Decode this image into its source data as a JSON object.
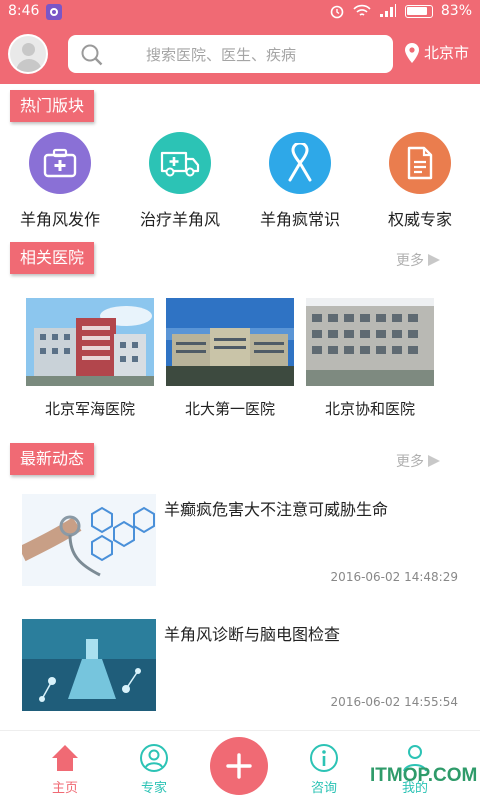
{
  "status": {
    "time": "8:46",
    "battery": "83%"
  },
  "header": {
    "search_placeholder": "搜索医院、医生、疾病",
    "location": "北京市"
  },
  "sections": {
    "hot": "热门版块",
    "hospitals": "相关医院",
    "news": "最新动态",
    "more": "更多"
  },
  "hot_items": [
    {
      "label": "羊角风发作",
      "icon": "medical-kit-icon",
      "color": "#8a70d6"
    },
    {
      "label": "治疗羊角风",
      "icon": "ambulance-icon",
      "color": "#2cc3b5"
    },
    {
      "label": "羊角疯常识",
      "icon": "ribbon-icon",
      "color": "#2ea8e8"
    },
    {
      "label": "权威专家",
      "icon": "document-icon",
      "color": "#ea7d4e"
    }
  ],
  "hospitals": [
    {
      "name": "北京军海医院"
    },
    {
      "name": "北大第一医院"
    },
    {
      "name": "北京协和医院"
    }
  ],
  "news": [
    {
      "title": "羊癫疯危害大不注意可威胁生命",
      "time": "2016-06-02 14:48:29"
    },
    {
      "title": "羊角风诊断与脑电图检查",
      "time": "2016-06-02 14:55:54"
    }
  ],
  "tabs": [
    {
      "label": "主页",
      "icon": "home-icon",
      "color": "#f06a74"
    },
    {
      "label": "专家",
      "icon": "expert-icon",
      "color": "#2cc3b5"
    },
    {
      "label": "咨询",
      "icon": "info-icon",
      "color": "#2cc3b5"
    },
    {
      "label": "我的",
      "icon": "user-icon",
      "color": "#2cc3b5"
    }
  ],
  "watermark": "ITMOP.COM",
  "colors": {
    "accent": "#f06a74"
  }
}
